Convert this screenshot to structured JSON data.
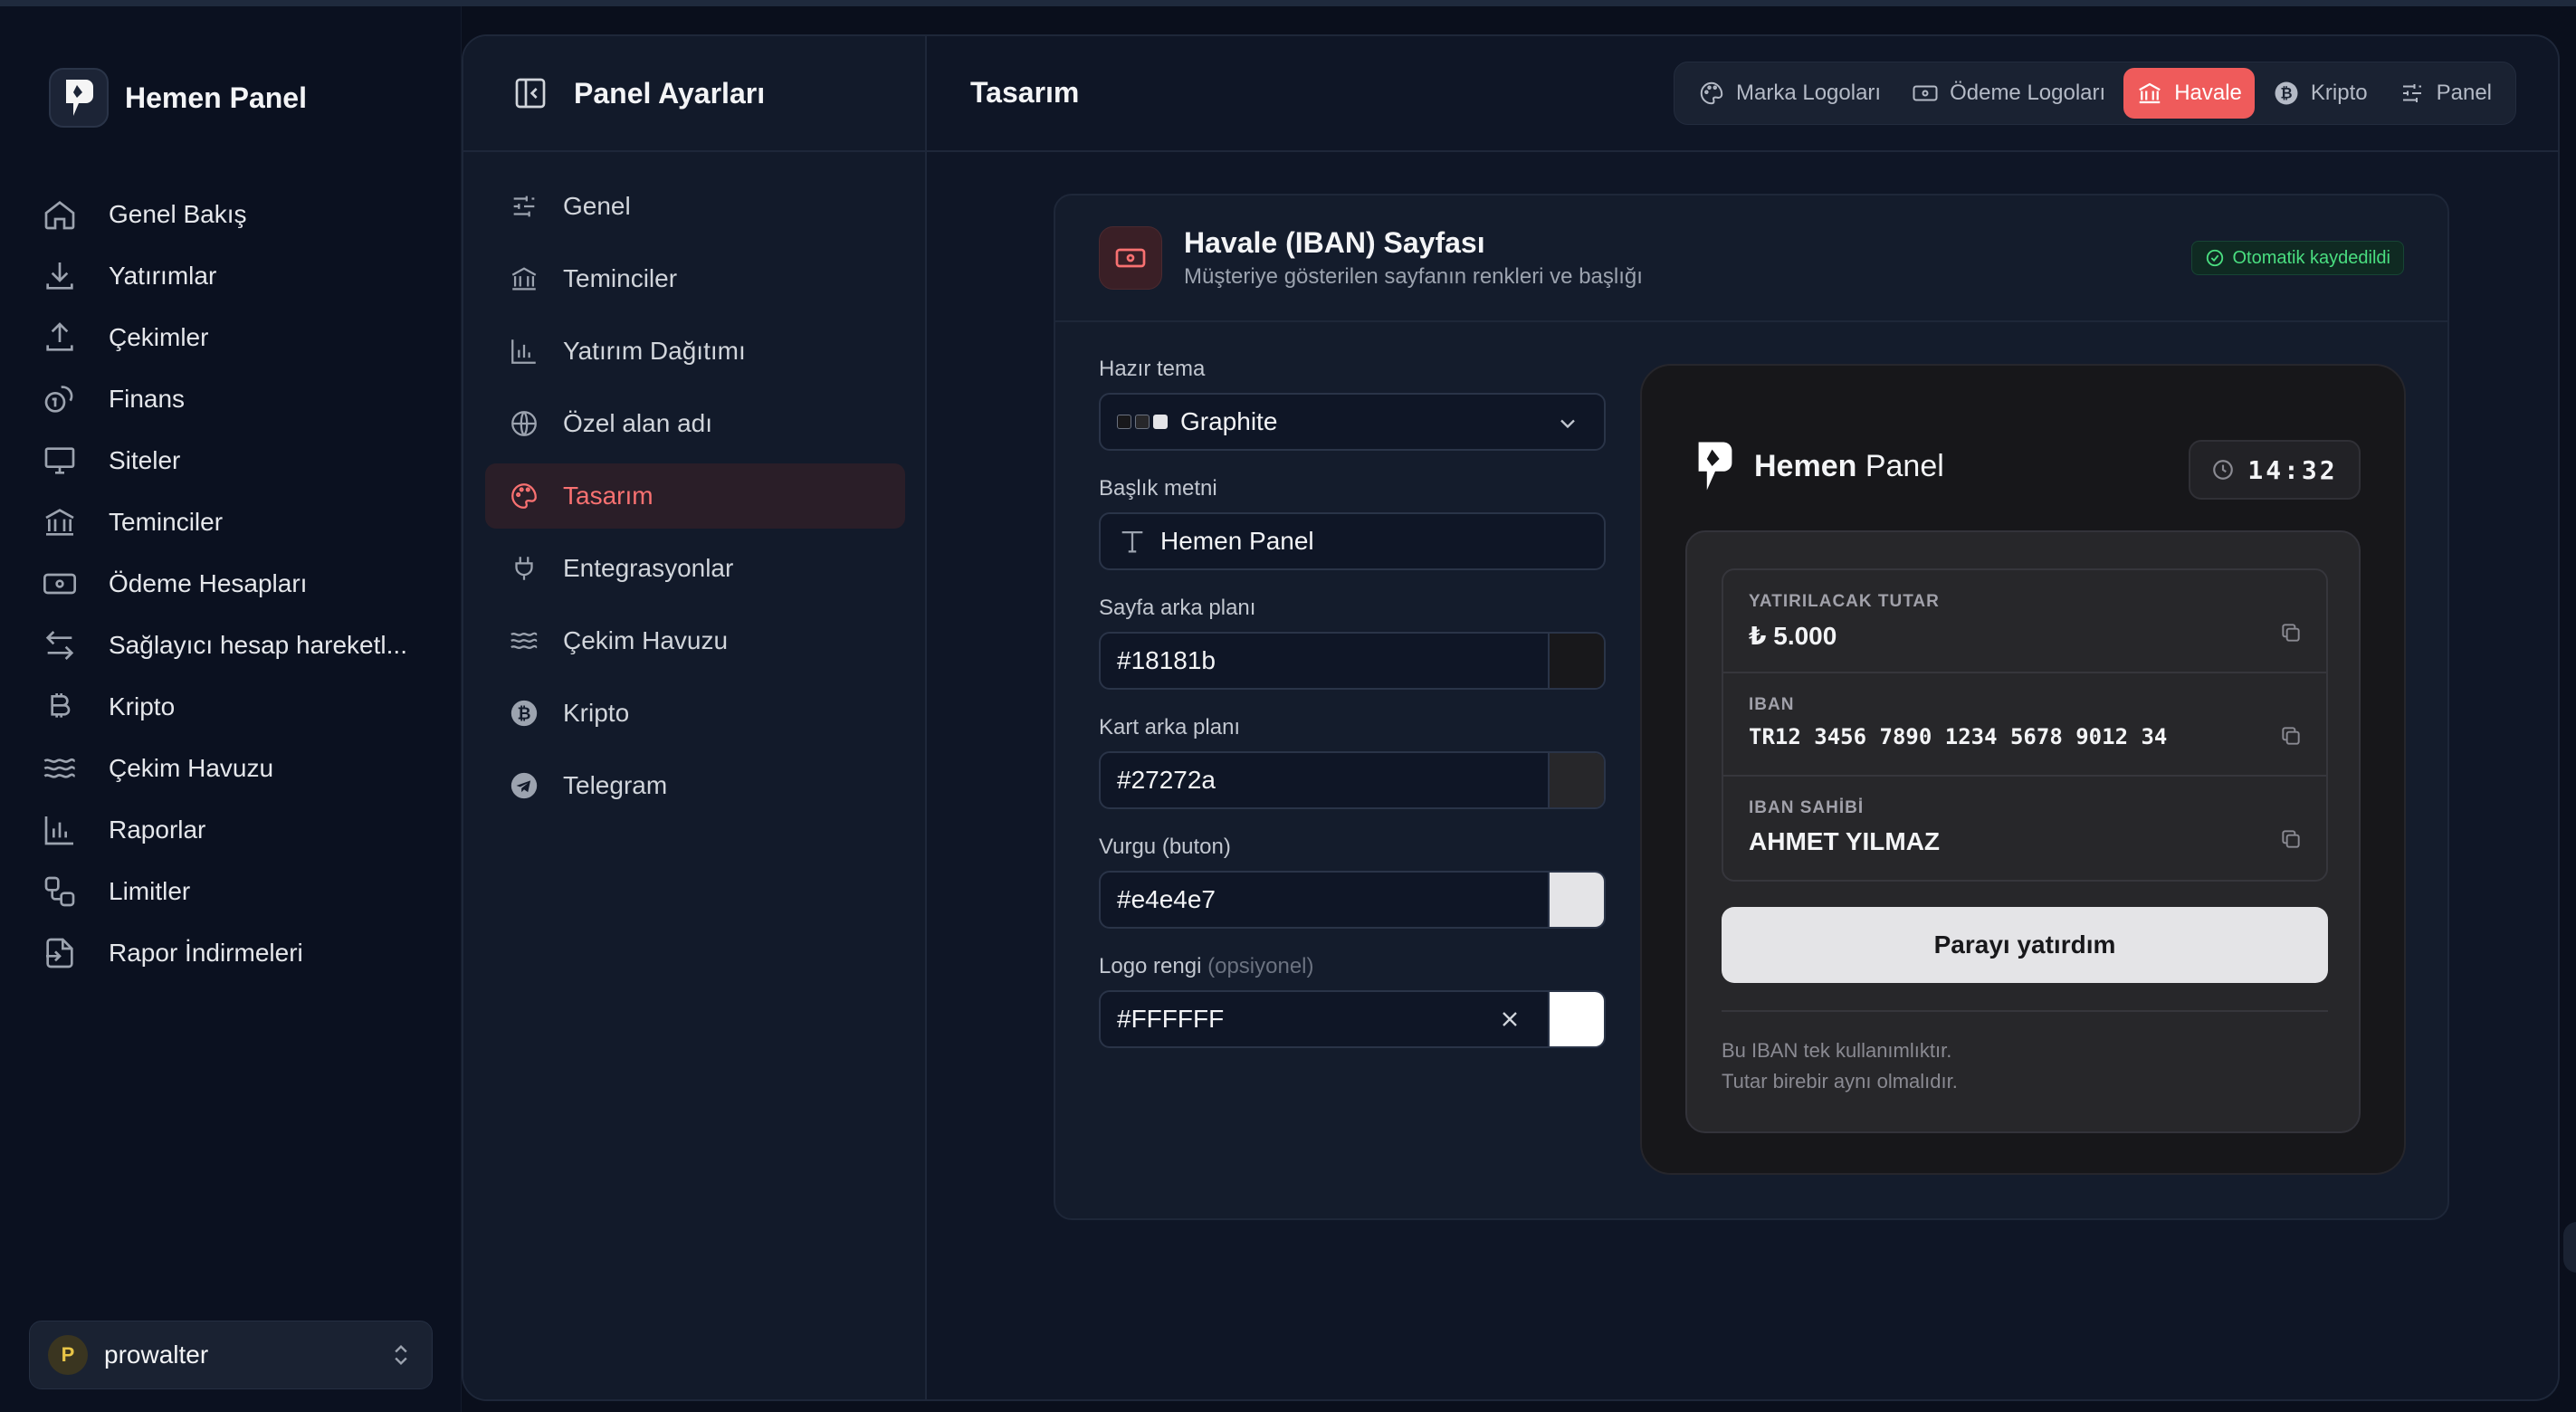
{
  "app": {
    "name": "Hemen Panel"
  },
  "sidebar": {
    "items": [
      {
        "label": "Genel Bakış",
        "icon": "home-icon"
      },
      {
        "label": "Yatırımlar",
        "icon": "download-icon"
      },
      {
        "label": "Çekimler",
        "icon": "upload-icon"
      },
      {
        "label": "Finans",
        "icon": "coins-icon"
      },
      {
        "label": "Siteler",
        "icon": "monitor-icon"
      },
      {
        "label": "Teminciler",
        "icon": "bank-icon"
      },
      {
        "label": "Ödeme Hesapları",
        "icon": "banknote-icon"
      },
      {
        "label": "Sağlayıcı hesap hareketl...",
        "icon": "arrows-left-right-icon"
      },
      {
        "label": "Kripto",
        "icon": "bitcoin-icon"
      },
      {
        "label": "Çekim Havuzu",
        "icon": "waves-icon"
      },
      {
        "label": "Raporlar",
        "icon": "bar-chart-icon"
      },
      {
        "label": "Limitler",
        "icon": "workflow-icon"
      },
      {
        "label": "Rapor İndirmeleri",
        "icon": "file-export-icon"
      }
    ],
    "user": {
      "initial": "P",
      "name": "prowalter"
    }
  },
  "settings": {
    "title": "Panel Ayarları",
    "items": [
      {
        "label": "Genel",
        "icon": "sliders-icon"
      },
      {
        "label": "Teminciler",
        "icon": "bank-icon"
      },
      {
        "label": "Yatırım Dağıtımı",
        "icon": "bar-chart-icon"
      },
      {
        "label": "Özel alan adı",
        "icon": "globe-icon"
      },
      {
        "label": "Tasarım",
        "icon": "palette-icon",
        "active": true
      },
      {
        "label": "Entegrasyonlar",
        "icon": "plug-icon"
      },
      {
        "label": "Çekim Havuzu",
        "icon": "waves-icon"
      },
      {
        "label": "Kripto",
        "icon": "bitcoin-icon"
      },
      {
        "label": "Telegram",
        "icon": "telegram-icon"
      }
    ]
  },
  "content": {
    "title": "Tasarım",
    "tabs": [
      {
        "label": "Marka Logoları",
        "icon": "palette-icon"
      },
      {
        "label": "Ödeme Logoları",
        "icon": "banknote-icon"
      },
      {
        "label": "Havale",
        "icon": "bank-icon",
        "active": true
      },
      {
        "label": "Kripto",
        "icon": "bitcoin-icon"
      },
      {
        "label": "Panel",
        "icon": "sliders-icon"
      }
    ]
  },
  "card": {
    "title": "Havale (IBAN) Sayfası",
    "subtitle": "Müşteriye gösterilen sayfanın renkleri ve başlığı",
    "autosave": "Otomatik kaydedildi"
  },
  "form": {
    "theme_label": "Hazır tema",
    "theme_value": "Graphite",
    "heading_label": "Başlık metni",
    "heading_value": "Hemen Panel",
    "page_bg_label": "Sayfa arka planı",
    "page_bg_value": "#18181b",
    "card_bg_label": "Kart arka planı",
    "card_bg_value": "#27272a",
    "accent_label": "Vurgu (buton)",
    "accent_value": "#e4e4e7",
    "logo_label": "Logo rengi",
    "logo_optional": "(opsiyonel)",
    "logo_value": "#FFFFFF"
  },
  "preview": {
    "brand_bold": "Hemen",
    "brand_rest": "Panel",
    "clock": "14:32",
    "amount_label": "YATIRILACAK TUTAR",
    "amount_value": "₺ 5.000",
    "iban_label": "IBAN",
    "iban_value": "TR12 3456 7890 1234 5678 9012 34",
    "holder_label": "IBAN SAHİBİ",
    "holder_value": "AHMET YILMAZ",
    "button": "Parayı yatırdım",
    "note1": "Bu IBAN tek kullanımlıktır.",
    "note2": "Tutar birebir aynı olmalıdır."
  },
  "colors": {
    "accent": "#ef5b5b",
    "success": "#4ade80",
    "page_bg": "#18181b",
    "card_bg": "#27272a",
    "button": "#e4e4e7",
    "logo": "#FFFFFF"
  }
}
